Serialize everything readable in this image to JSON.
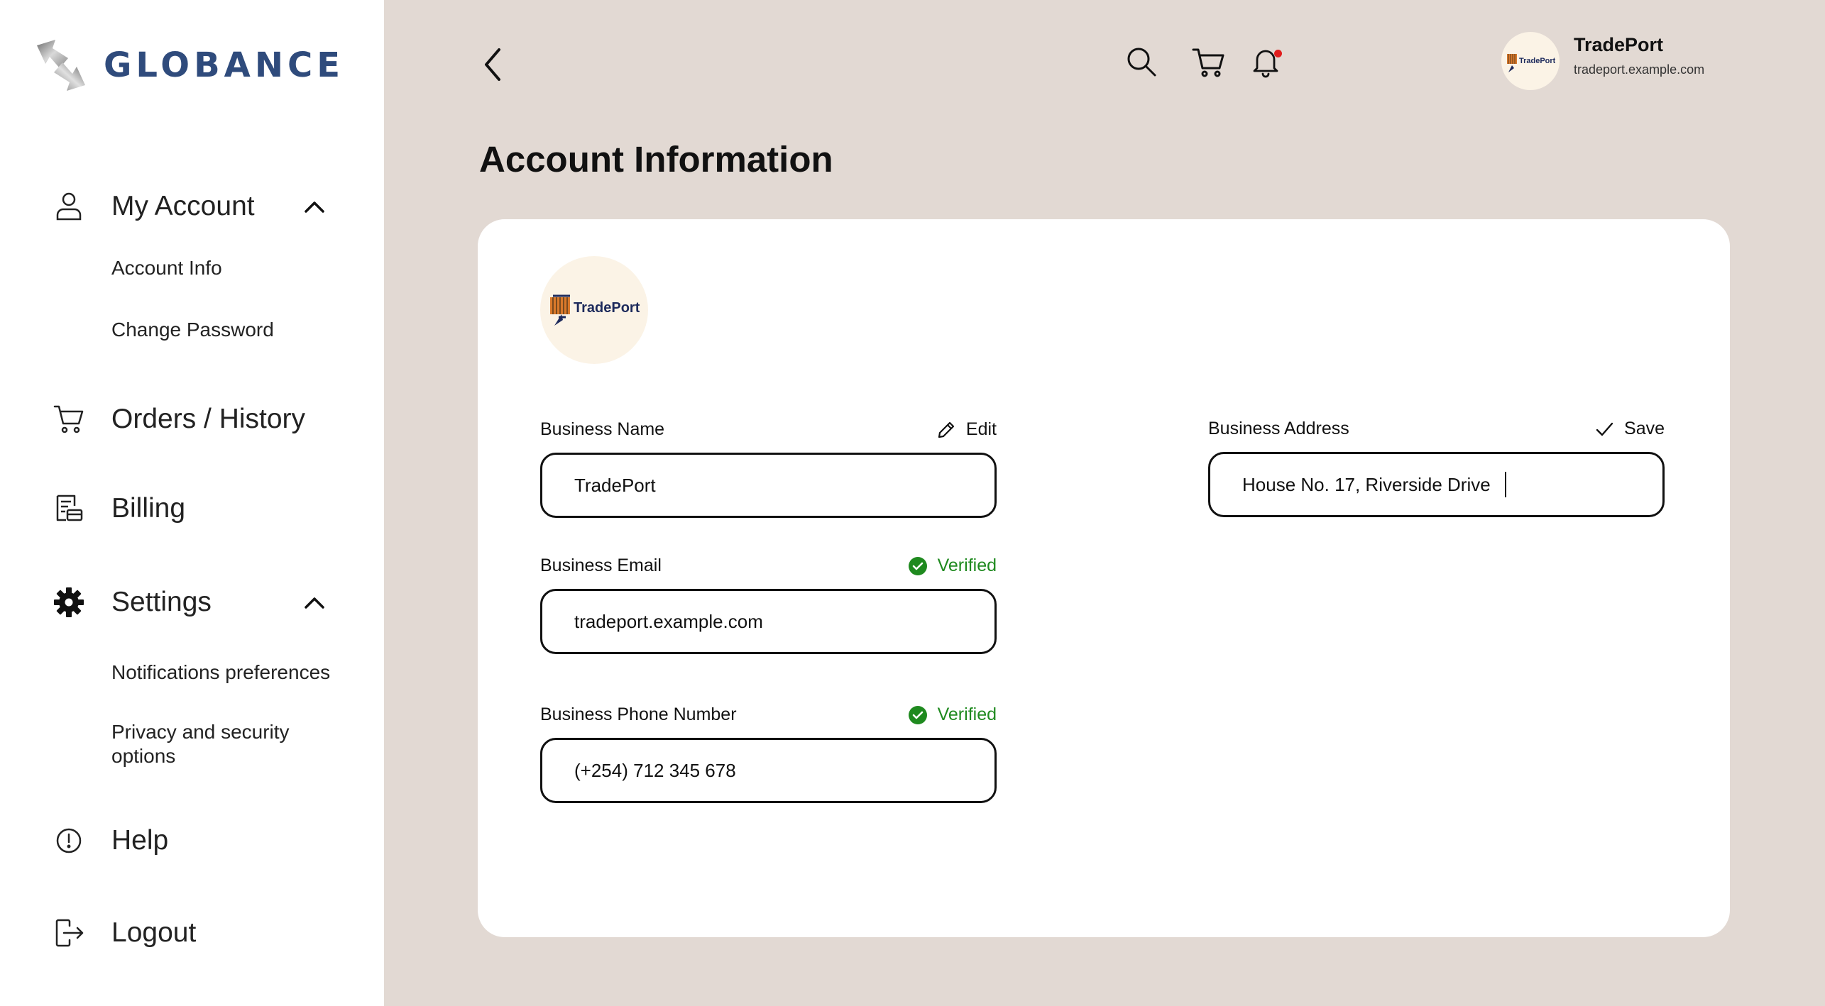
{
  "brand": {
    "name": "GLOBANCE"
  },
  "sidebar": {
    "my_account": "My Account",
    "account_info": "Account Info",
    "change_password": "Change Password",
    "orders": "Orders / History",
    "billing": "Billing",
    "settings": "Settings",
    "notifications": "Notifications preferences",
    "privacy": "Privacy and security options",
    "help": "Help",
    "logout": "Logout"
  },
  "header": {
    "profile_name": "TradePort",
    "profile_url": "tradeport.example.com",
    "notification_dot_color": "#e11d1d"
  },
  "page": {
    "title": "Account Information"
  },
  "company_logo": {
    "text": "TradePort"
  },
  "fields": {
    "business_name": {
      "label": "Business Name",
      "action": "Edit",
      "value": "TradePort"
    },
    "business_email": {
      "label": "Business Email",
      "status": "Verified",
      "value": "tradeport.example.com"
    },
    "business_phone": {
      "label": "Business Phone Number",
      "status": "Verified",
      "value": "(+254) 712 345 678"
    },
    "business_address": {
      "label": "Business Address",
      "action": "Save",
      "value": "House No. 17, Riverside Drive"
    }
  },
  "colors": {
    "background": "#e2d9d3",
    "brand": "#2f4b7c",
    "verified": "#1f8a1f"
  }
}
